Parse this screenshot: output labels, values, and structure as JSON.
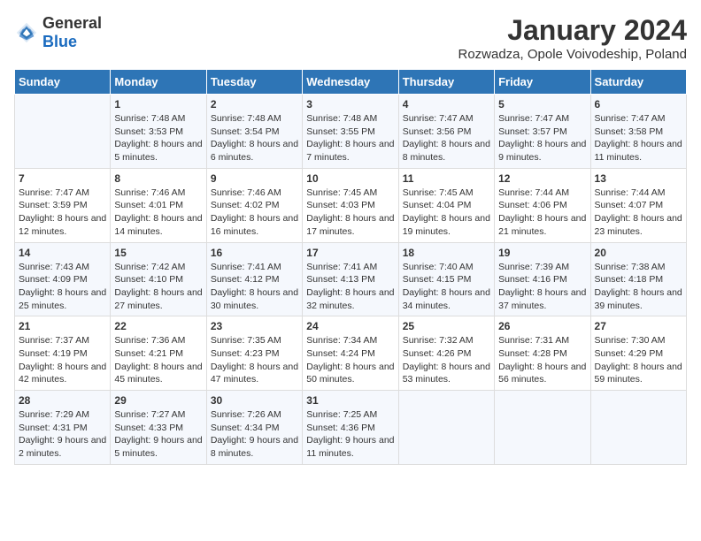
{
  "logo": {
    "general": "General",
    "blue": "Blue"
  },
  "title": "January 2024",
  "subtitle": "Rozwadza, Opole Voivodeship, Poland",
  "headers": [
    "Sunday",
    "Monday",
    "Tuesday",
    "Wednesday",
    "Thursday",
    "Friday",
    "Saturday"
  ],
  "weeks": [
    [
      {
        "day": "",
        "sunrise": "",
        "sunset": "",
        "daylight": ""
      },
      {
        "day": "1",
        "sunrise": "Sunrise: 7:48 AM",
        "sunset": "Sunset: 3:53 PM",
        "daylight": "Daylight: 8 hours and 5 minutes."
      },
      {
        "day": "2",
        "sunrise": "Sunrise: 7:48 AM",
        "sunset": "Sunset: 3:54 PM",
        "daylight": "Daylight: 8 hours and 6 minutes."
      },
      {
        "day": "3",
        "sunrise": "Sunrise: 7:48 AM",
        "sunset": "Sunset: 3:55 PM",
        "daylight": "Daylight: 8 hours and 7 minutes."
      },
      {
        "day": "4",
        "sunrise": "Sunrise: 7:47 AM",
        "sunset": "Sunset: 3:56 PM",
        "daylight": "Daylight: 8 hours and 8 minutes."
      },
      {
        "day": "5",
        "sunrise": "Sunrise: 7:47 AM",
        "sunset": "Sunset: 3:57 PM",
        "daylight": "Daylight: 8 hours and 9 minutes."
      },
      {
        "day": "6",
        "sunrise": "Sunrise: 7:47 AM",
        "sunset": "Sunset: 3:58 PM",
        "daylight": "Daylight: 8 hours and 11 minutes."
      }
    ],
    [
      {
        "day": "7",
        "sunrise": "Sunrise: 7:47 AM",
        "sunset": "Sunset: 3:59 PM",
        "daylight": "Daylight: 8 hours and 12 minutes."
      },
      {
        "day": "8",
        "sunrise": "Sunrise: 7:46 AM",
        "sunset": "Sunset: 4:01 PM",
        "daylight": "Daylight: 8 hours and 14 minutes."
      },
      {
        "day": "9",
        "sunrise": "Sunrise: 7:46 AM",
        "sunset": "Sunset: 4:02 PM",
        "daylight": "Daylight: 8 hours and 16 minutes."
      },
      {
        "day": "10",
        "sunrise": "Sunrise: 7:45 AM",
        "sunset": "Sunset: 4:03 PM",
        "daylight": "Daylight: 8 hours and 17 minutes."
      },
      {
        "day": "11",
        "sunrise": "Sunrise: 7:45 AM",
        "sunset": "Sunset: 4:04 PM",
        "daylight": "Daylight: 8 hours and 19 minutes."
      },
      {
        "day": "12",
        "sunrise": "Sunrise: 7:44 AM",
        "sunset": "Sunset: 4:06 PM",
        "daylight": "Daylight: 8 hours and 21 minutes."
      },
      {
        "day": "13",
        "sunrise": "Sunrise: 7:44 AM",
        "sunset": "Sunset: 4:07 PM",
        "daylight": "Daylight: 8 hours and 23 minutes."
      }
    ],
    [
      {
        "day": "14",
        "sunrise": "Sunrise: 7:43 AM",
        "sunset": "Sunset: 4:09 PM",
        "daylight": "Daylight: 8 hours and 25 minutes."
      },
      {
        "day": "15",
        "sunrise": "Sunrise: 7:42 AM",
        "sunset": "Sunset: 4:10 PM",
        "daylight": "Daylight: 8 hours and 27 minutes."
      },
      {
        "day": "16",
        "sunrise": "Sunrise: 7:41 AM",
        "sunset": "Sunset: 4:12 PM",
        "daylight": "Daylight: 8 hours and 30 minutes."
      },
      {
        "day": "17",
        "sunrise": "Sunrise: 7:41 AM",
        "sunset": "Sunset: 4:13 PM",
        "daylight": "Daylight: 8 hours and 32 minutes."
      },
      {
        "day": "18",
        "sunrise": "Sunrise: 7:40 AM",
        "sunset": "Sunset: 4:15 PM",
        "daylight": "Daylight: 8 hours and 34 minutes."
      },
      {
        "day": "19",
        "sunrise": "Sunrise: 7:39 AM",
        "sunset": "Sunset: 4:16 PM",
        "daylight": "Daylight: 8 hours and 37 minutes."
      },
      {
        "day": "20",
        "sunrise": "Sunrise: 7:38 AM",
        "sunset": "Sunset: 4:18 PM",
        "daylight": "Daylight: 8 hours and 39 minutes."
      }
    ],
    [
      {
        "day": "21",
        "sunrise": "Sunrise: 7:37 AM",
        "sunset": "Sunset: 4:19 PM",
        "daylight": "Daylight: 8 hours and 42 minutes."
      },
      {
        "day": "22",
        "sunrise": "Sunrise: 7:36 AM",
        "sunset": "Sunset: 4:21 PM",
        "daylight": "Daylight: 8 hours and 45 minutes."
      },
      {
        "day": "23",
        "sunrise": "Sunrise: 7:35 AM",
        "sunset": "Sunset: 4:23 PM",
        "daylight": "Daylight: 8 hours and 47 minutes."
      },
      {
        "day": "24",
        "sunrise": "Sunrise: 7:34 AM",
        "sunset": "Sunset: 4:24 PM",
        "daylight": "Daylight: 8 hours and 50 minutes."
      },
      {
        "day": "25",
        "sunrise": "Sunrise: 7:32 AM",
        "sunset": "Sunset: 4:26 PM",
        "daylight": "Daylight: 8 hours and 53 minutes."
      },
      {
        "day": "26",
        "sunrise": "Sunrise: 7:31 AM",
        "sunset": "Sunset: 4:28 PM",
        "daylight": "Daylight: 8 hours and 56 minutes."
      },
      {
        "day": "27",
        "sunrise": "Sunrise: 7:30 AM",
        "sunset": "Sunset: 4:29 PM",
        "daylight": "Daylight: 8 hours and 59 minutes."
      }
    ],
    [
      {
        "day": "28",
        "sunrise": "Sunrise: 7:29 AM",
        "sunset": "Sunset: 4:31 PM",
        "daylight": "Daylight: 9 hours and 2 minutes."
      },
      {
        "day": "29",
        "sunrise": "Sunrise: 7:27 AM",
        "sunset": "Sunset: 4:33 PM",
        "daylight": "Daylight: 9 hours and 5 minutes."
      },
      {
        "day": "30",
        "sunrise": "Sunrise: 7:26 AM",
        "sunset": "Sunset: 4:34 PM",
        "daylight": "Daylight: 9 hours and 8 minutes."
      },
      {
        "day": "31",
        "sunrise": "Sunrise: 7:25 AM",
        "sunset": "Sunset: 4:36 PM",
        "daylight": "Daylight: 9 hours and 11 minutes."
      },
      {
        "day": "",
        "sunrise": "",
        "sunset": "",
        "daylight": ""
      },
      {
        "day": "",
        "sunrise": "",
        "sunset": "",
        "daylight": ""
      },
      {
        "day": "",
        "sunrise": "",
        "sunset": "",
        "daylight": ""
      }
    ]
  ]
}
